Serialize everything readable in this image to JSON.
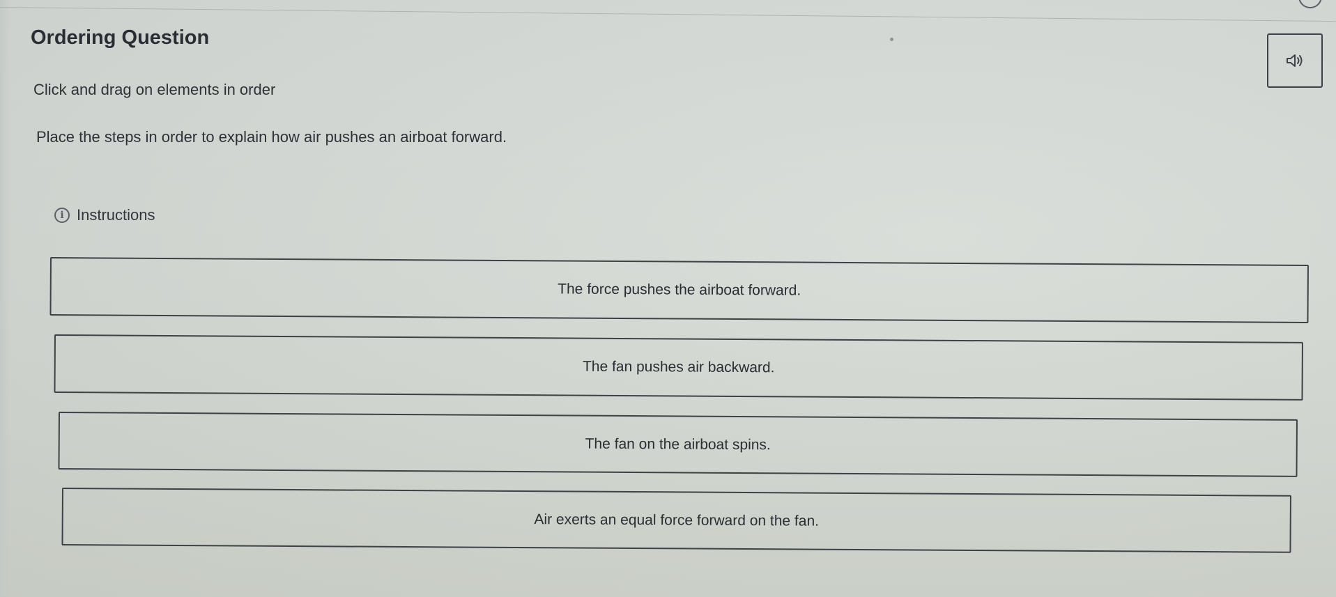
{
  "header": {
    "title": "Ordering Question",
    "subtitle": "Click and drag on elements in order"
  },
  "question": {
    "prompt": "Place the steps in order to explain how air pushes an airboat forward."
  },
  "instructions": {
    "label": "Instructions",
    "icon": "info-circle-icon"
  },
  "audio": {
    "icon": "speaker-icon"
  },
  "items": [
    {
      "label": "The force pushes the airboat forward."
    },
    {
      "label": "The fan pushes air backward."
    },
    {
      "label": "The fan on the airboat spins."
    },
    {
      "label": "Air exerts an equal force forward on the fan."
    }
  ]
}
